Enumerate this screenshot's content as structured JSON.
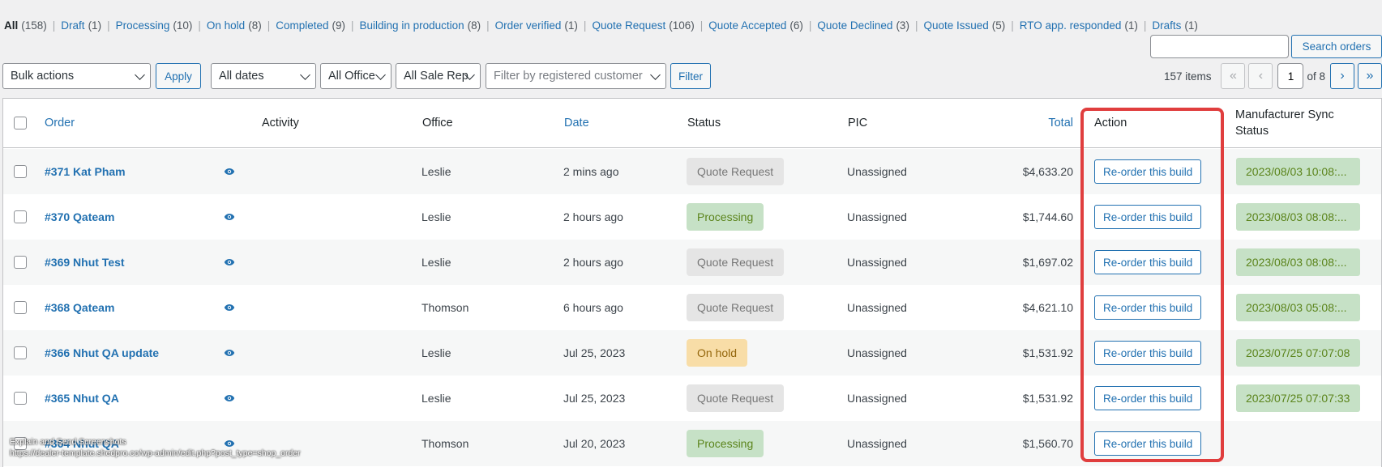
{
  "status_filters": [
    {
      "label": "All",
      "count": "(158)",
      "current": true
    },
    {
      "label": "Draft",
      "count": "(1)"
    },
    {
      "label": "Processing",
      "count": "(10)"
    },
    {
      "label": "On hold",
      "count": "(8)"
    },
    {
      "label": "Completed",
      "count": "(9)"
    },
    {
      "label": "Building in production",
      "count": "(8)"
    },
    {
      "label": "Order verified",
      "count": "(1)"
    },
    {
      "label": "Quote Request",
      "count": "(106)"
    },
    {
      "label": "Quote Accepted",
      "count": "(6)"
    },
    {
      "label": "Quote Declined",
      "count": "(3)"
    },
    {
      "label": "Quote Issued",
      "count": "(5)"
    },
    {
      "label": "RTO app. responded",
      "count": "(1)"
    },
    {
      "label": "Drafts",
      "count": "(1)"
    }
  ],
  "search": {
    "placeholder": "",
    "button": "Search orders"
  },
  "tablenav": {
    "bulk_actions": "Bulk actions",
    "apply": "Apply",
    "dates": "All dates",
    "office": "All Office",
    "sale_rep": "All Sale Rep",
    "customer_placeholder": "Filter by registered customer",
    "filter": "Filter",
    "items": "157 items",
    "first": "«",
    "prev": "‹",
    "current_page": "1",
    "of_pages": "of 8",
    "next": "›",
    "last": "»"
  },
  "columns": {
    "order": "Order",
    "activity": "Activity",
    "office": "Office",
    "date": "Date",
    "status": "Status",
    "pic": "PIC",
    "total": "Total",
    "action": "Action",
    "sync_line1": "Manufacturer Sync",
    "sync_line2": "Status"
  },
  "rows": [
    {
      "order": "#371 Kat Pham",
      "office": "Leslie",
      "date": "2 mins ago",
      "status": "Quote Request",
      "status_type": "quote",
      "pic": "Unassigned",
      "total": "$4,633.20",
      "action": "Re-order this build",
      "sync": "2023/08/03 10:08:..."
    },
    {
      "order": "#370 Qateam",
      "office": "Leslie",
      "date": "2 hours ago",
      "status": "Processing",
      "status_type": "processing",
      "pic": "Unassigned",
      "total": "$1,744.60",
      "action": "Re-order this build",
      "sync": "2023/08/03 08:08:..."
    },
    {
      "order": "#369 Nhut Test",
      "office": "Leslie",
      "date": "2 hours ago",
      "status": "Quote Request",
      "status_type": "quote",
      "pic": "Unassigned",
      "total": "$1,697.02",
      "action": "Re-order this build",
      "sync": "2023/08/03 08:08:..."
    },
    {
      "order": "#368 Qateam",
      "office": "Thomson",
      "date": "6 hours ago",
      "status": "Quote Request",
      "status_type": "quote",
      "pic": "Unassigned",
      "total": "$4,621.10",
      "action": "Re-order this build",
      "sync": "2023/08/03 05:08:..."
    },
    {
      "order": "#366 Nhut QA update",
      "office": "Leslie",
      "date": "Jul 25, 2023",
      "status": "On hold",
      "status_type": "onhold",
      "pic": "Unassigned",
      "total": "$1,531.92",
      "action": "Re-order this build",
      "sync": "2023/07/25 07:07:08"
    },
    {
      "order": "#365 Nhut QA",
      "office": "Leslie",
      "date": "Jul 25, 2023",
      "status": "Quote Request",
      "status_type": "quote",
      "pic": "Unassigned",
      "total": "$1,531.92",
      "action": "Re-order this build",
      "sync": "2023/07/25 07:07:33"
    },
    {
      "order": "#364 Nhut QA",
      "office": "Thomson",
      "date": "Jul 20, 2023",
      "status": "Processing",
      "status_type": "processing",
      "pic": "Unassigned",
      "total": "$1,560.70",
      "action": "Re-order this build",
      "sync": ""
    }
  ],
  "overlay": {
    "caption": "Explain and Send Screenshots",
    "url": "https://dealer-template.shedpro.co/wp-admin/edit.php?post_type=shop_order"
  },
  "colors": {
    "link": "#2271b1",
    "highlight": "#e03e3e",
    "processing_bg": "#c6e1c6",
    "onhold_bg": "#f8dda7",
    "quote_bg": "#e5e5e5"
  }
}
